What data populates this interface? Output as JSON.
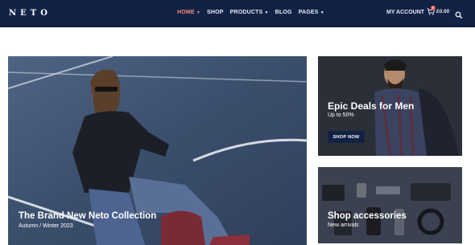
{
  "header": {
    "logo": "NETO",
    "nav": [
      {
        "label": "HOME",
        "has_dropdown": true,
        "active": true
      },
      {
        "label": "SHOP",
        "has_dropdown": false,
        "active": false
      },
      {
        "label": "PRODUCTS",
        "has_dropdown": true,
        "active": false
      },
      {
        "label": "BLOG",
        "has_dropdown": false,
        "active": false
      },
      {
        "label": "PAGES",
        "has_dropdown": true,
        "active": false
      }
    ],
    "account": "MY ACCOUNT",
    "cart_count": "0",
    "cart_total": "£0.00",
    "icons": {
      "cart": "cart-icon",
      "search": "search-icon",
      "dropdown": "caret-down-icon"
    }
  },
  "hero": {
    "title": "The Brand New Neto Collection",
    "subtitle": "Autumn / Winter 2023"
  },
  "promo_men": {
    "title": "Epic Deals for Men",
    "subtitle": "Up to 50%",
    "button": "SHOP NOW"
  },
  "promo_accessories": {
    "title": "Shop accessories",
    "subtitle": "New arrivals"
  },
  "colors": {
    "header_bg": "#112244",
    "nav_active": "#f08c7a",
    "button_bg": "#112244",
    "badge": "#e0564a"
  }
}
